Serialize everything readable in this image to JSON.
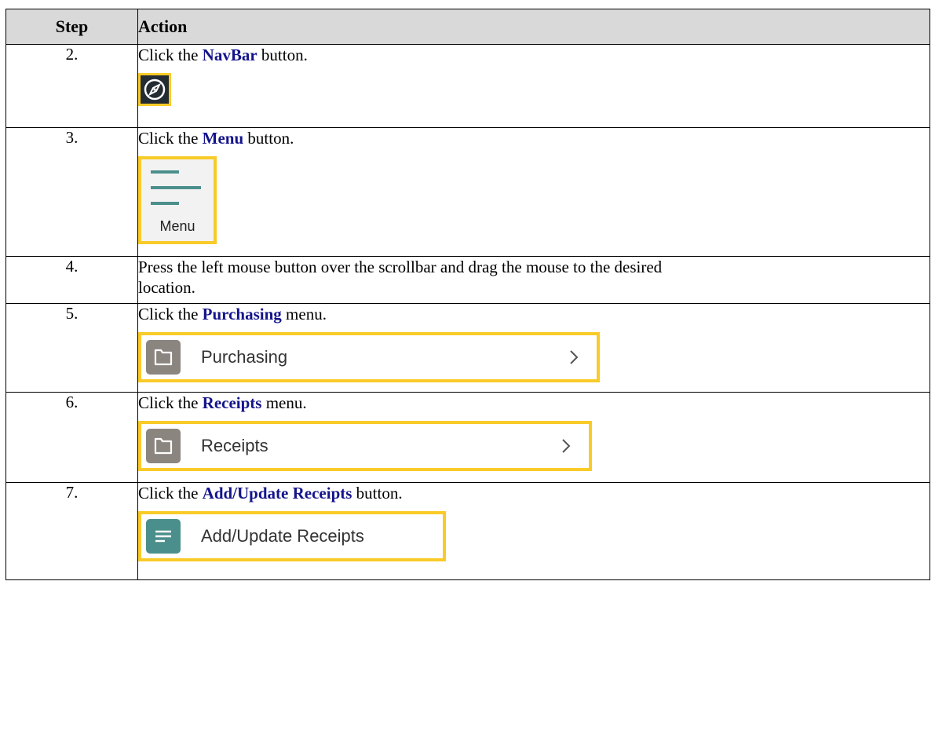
{
  "header": {
    "step": "Step",
    "action": "Action"
  },
  "steps": [
    {
      "num": "2.",
      "pre": "Click the ",
      "kw": "NavBar",
      "post": " button."
    },
    {
      "num": "3.",
      "pre": "Click the ",
      "kw": "Menu",
      "post": " button.",
      "image_label": "Menu"
    },
    {
      "num": "4.",
      "line1": "Press the left mouse button over the scrollbar and drag the mouse to the desired",
      "line2": "location."
    },
    {
      "num": "5.",
      "pre": "Click the ",
      "kw": "Purchasing",
      "post": " menu.",
      "image_label": "Purchasing"
    },
    {
      "num": "6.",
      "pre": "Click the ",
      "kw": "Receipts",
      "post": " menu.",
      "image_label": "Receipts"
    },
    {
      "num": "7.",
      "pre": "Click the ",
      "kw": "Add/Update Receipts",
      "post": " button.",
      "image_label": "Add/Update Receipts"
    }
  ],
  "colors": {
    "keyword": "#14148c",
    "highlight": "#f9cb28",
    "teal": "#4b8f8c",
    "folder_gray": "#8b8580",
    "header_bg": "#d9d9d9"
  },
  "icons": {
    "navbar": "compass-icon",
    "menu": "hamburger-menu-icon",
    "folder": "folder-icon",
    "chevron": "chevron-right-icon",
    "document": "document-lines-icon"
  }
}
